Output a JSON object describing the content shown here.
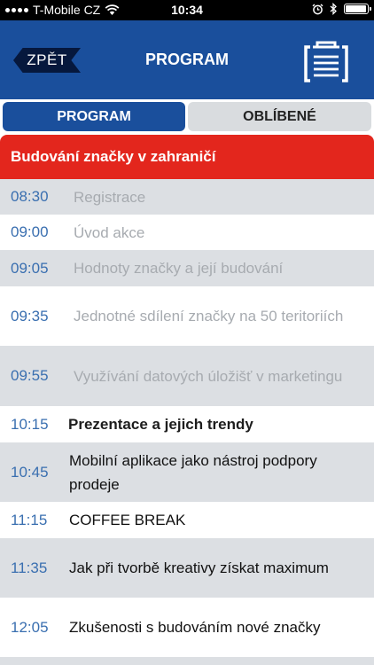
{
  "status_bar": {
    "carrier": "T-Mobile CZ",
    "time": "10:34",
    "battery_level": 0.88
  },
  "header": {
    "back_label": "ZPĚT",
    "title": "PROGRAM",
    "clipboard_icon": "clipboard-icon"
  },
  "tabs": [
    {
      "label": "PROGRAM",
      "active": true
    },
    {
      "label": "OBLÍBENÉ",
      "active": false
    }
  ],
  "section": {
    "title": "Budování značky v zahraničí"
  },
  "schedule": [
    {
      "time": "08:30",
      "title": "Registrace"
    },
    {
      "time": "09:00",
      "title": "Úvod akce"
    },
    {
      "time": "09:05",
      "title": "Hodnoty značky a její budování"
    },
    {
      "time": "09:35",
      "title": "Jednotné sdílení značky na 50 teritoriích"
    },
    {
      "time": "09:55",
      "title": "Využívání datových úložišť v marketingu"
    },
    {
      "time": "10:15",
      "title": "Prezentace a jejich trendy"
    },
    {
      "time": "10:45",
      "title": "Mobilní aplikace jako nástroj podpory prodeje"
    },
    {
      "time": "11:15",
      "title": "COFFEE BREAK"
    },
    {
      "time": "11:35",
      "title": "Jak při tvorbě kreativy získat maximum"
    },
    {
      "time": "12:05",
      "title": "Zkušenosti s budováním nové značky"
    }
  ],
  "colors": {
    "header_blue": "#1a4f9c",
    "section_red": "#e3261d",
    "time_blue": "#3a6fb0"
  }
}
